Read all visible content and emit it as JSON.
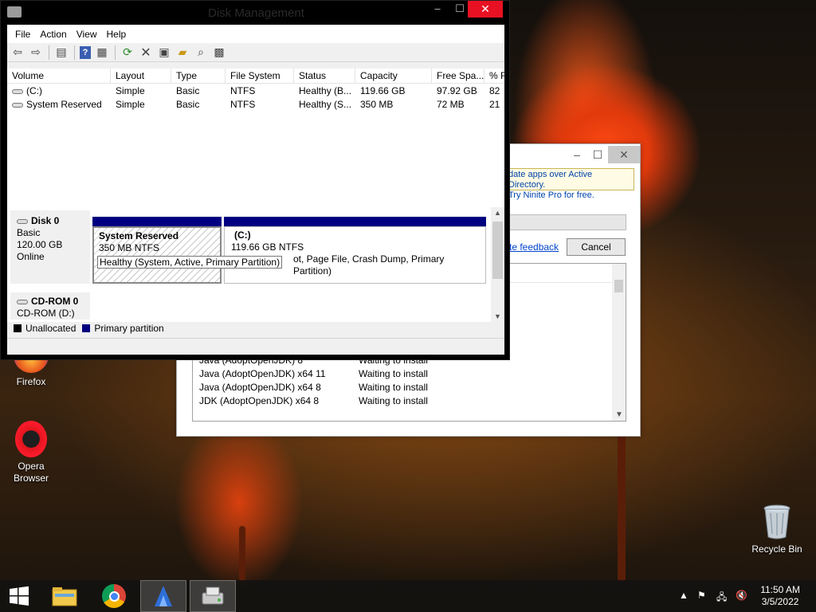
{
  "desktop": {
    "icons": [
      {
        "label": "Firefox"
      },
      {
        "label": "Opera\nBrowser"
      },
      {
        "label": "Recycle Bin"
      }
    ]
  },
  "ninite": {
    "notice_line1": "date apps over Active Directory.",
    "notice_line2": "Try Ninite Pro for free.",
    "feedback": "te feedback",
    "cancel": "Cancel",
    "rows": [
      {
        "name": "Java (AdoptOpenJDK) 8",
        "status": "Waiting to install"
      },
      {
        "name": "Java (AdoptOpenJDK) x64 11",
        "status": "Waiting to install"
      },
      {
        "name": "Java (AdoptOpenJDK) x64 8",
        "status": "Waiting to install"
      },
      {
        "name": "JDK (AdoptOpenJDK) x64 8",
        "status": "Waiting to install"
      }
    ]
  },
  "dm": {
    "title": "Disk Management",
    "menu": [
      "File",
      "Action",
      "View",
      "Help"
    ],
    "columns": [
      "Volume",
      "Layout",
      "Type",
      "File System",
      "Status",
      "Capacity",
      "Free Spa...",
      "% F"
    ],
    "volumes": [
      {
        "volume": "(C:)",
        "layout": "Simple",
        "type": "Basic",
        "fs": "NTFS",
        "status": "Healthy (B...",
        "capacity": "119.66 GB",
        "free": "97.92 GB",
        "pct": "82"
      },
      {
        "volume": "System Reserved",
        "layout": "Simple",
        "type": "Basic",
        "fs": "NTFS",
        "status": "Healthy (S...",
        "capacity": "350 MB",
        "free": "72 MB",
        "pct": "21"
      }
    ],
    "disk0": {
      "name": "Disk 0",
      "type": "Basic",
      "size": "120.00 GB",
      "state": "Online"
    },
    "sysres": {
      "name": "System Reserved",
      "size": "350 MB NTFS"
    },
    "tooltip": "Healthy (System, Active, Primary Partition)",
    "cpart": {
      "name": "(C:)",
      "size": "119.66 GB NTFS",
      "status": "ot, Page File, Crash Dump, Primary Partition)"
    },
    "cdrom": {
      "name": "CD-ROM 0",
      "label": "CD-ROM (D:)"
    },
    "legend": {
      "unallocated": "Unallocated",
      "primary": "Primary partition"
    }
  },
  "taskbar": {
    "time": "11:50 AM",
    "date": "3/5/2022"
  }
}
